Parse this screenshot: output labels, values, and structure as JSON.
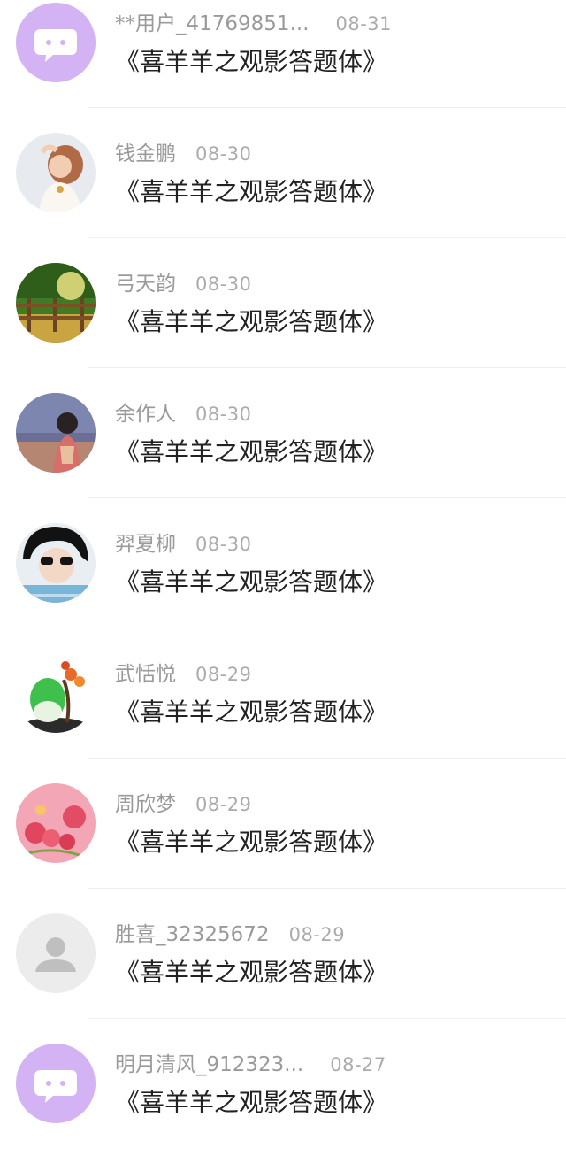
{
  "messages": [
    {
      "avatar": "chat-bubble-icon",
      "name": "**用户_41769851...",
      "date": "08-31",
      "title": "《喜羊羊之观影答题体》"
    },
    {
      "avatar": "user-photo",
      "name": "钱金鹏",
      "date": "08-30",
      "title": "《喜羊羊之观影答题体》"
    },
    {
      "avatar": "user-photo",
      "name": "弓天韵",
      "date": "08-30",
      "title": "《喜羊羊之观影答题体》"
    },
    {
      "avatar": "user-photo",
      "name": "余作人",
      "date": "08-30",
      "title": "《喜羊羊之观影答题体》"
    },
    {
      "avatar": "user-photo",
      "name": "羿夏柳",
      "date": "08-30",
      "title": "《喜羊羊之观影答题体》"
    },
    {
      "avatar": "user-photo",
      "name": "武恬悦",
      "date": "08-29",
      "title": "《喜羊羊之观影答题体》"
    },
    {
      "avatar": "user-photo",
      "name": "周欣梦",
      "date": "08-29",
      "title": "《喜羊羊之观影答题体》"
    },
    {
      "avatar": "default-user-icon",
      "name": "胜喜_32325672",
      "date": "08-29",
      "title": "《喜羊羊之观影答题体》"
    },
    {
      "avatar": "chat-bubble-icon",
      "name": "明月清风_912323...",
      "date": "08-27",
      "title": "《喜羊羊之观影答题体》"
    }
  ],
  "colors": {
    "name_text": "#9a9a9a",
    "date_text": "#ababab",
    "title_text": "#222222",
    "chat_avatar_bg": "#d3b3f3",
    "default_avatar_bg": "#ececec",
    "divider": "#eeeeee"
  }
}
